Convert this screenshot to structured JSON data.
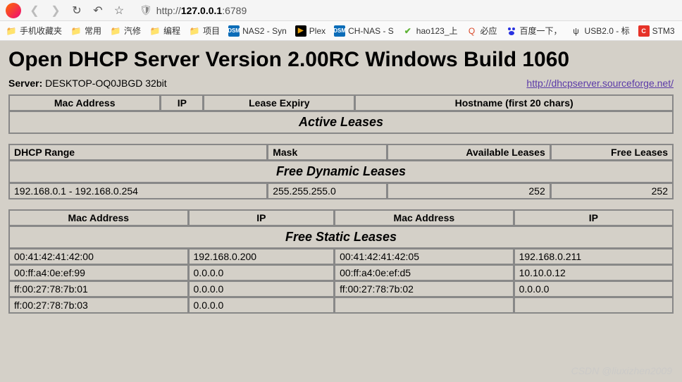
{
  "browser": {
    "url_prefix": "http://",
    "url_host": "127.0.0.1",
    "url_port": ":6789",
    "bookmarks": [
      {
        "icon": "folder",
        "label": "手机收藏夹"
      },
      {
        "icon": "folder",
        "label": "常用"
      },
      {
        "icon": "folder",
        "label": "汽修"
      },
      {
        "icon": "folder",
        "label": "编程"
      },
      {
        "icon": "folder",
        "label": "项目"
      },
      {
        "icon": "dsm",
        "label": "NAS2 - Syn"
      },
      {
        "icon": "plex",
        "label": "Plex"
      },
      {
        "icon": "dsm",
        "label": "CH-NAS - S"
      },
      {
        "icon": "hao",
        "label": "hao123_上"
      },
      {
        "icon": "biying",
        "label": "必应"
      },
      {
        "icon": "baidu",
        "label": "百度一下，"
      },
      {
        "icon": "usb",
        "label": "USB2.0 - 标"
      },
      {
        "icon": "stm",
        "label": "STM3"
      }
    ]
  },
  "page": {
    "title": "Open DHCP Server Version 2.00RC Windows Build 1060",
    "server_label": "Server:",
    "server_value": "DESKTOP-OQ0JBGD 32bit",
    "link_text": "http://dhcpserver.sourceforge.net/",
    "watermark": "CSDN @liuxizhen2009"
  },
  "active": {
    "title": "Active Leases",
    "headers": [
      "Mac Address",
      "IP",
      "Lease Expiry",
      "Hostname (first 20 chars)"
    ],
    "rows": []
  },
  "dynamic": {
    "title": "Free Dynamic Leases",
    "headers": [
      "DHCP Range",
      "Mask",
      "Available Leases",
      "Free Leases"
    ],
    "rows": [
      {
        "range": "192.168.0.1 - 192.168.0.254",
        "mask": "255.255.255.0",
        "available": "252",
        "free": "252"
      }
    ]
  },
  "static": {
    "title": "Free Static Leases",
    "headers": [
      "Mac Address",
      "IP",
      "Mac Address",
      "IP"
    ],
    "rows": [
      {
        "mac1": "00:41:42:41:42:00",
        "ip1": "192.168.0.200",
        "mac2": "00:41:42:41:42:05",
        "ip2": "192.168.0.211"
      },
      {
        "mac1": "00:ff:a4:0e:ef:99",
        "ip1": "0.0.0.0",
        "mac2": "00:ff:a4:0e:ef:d5",
        "ip2": "10.10.0.12"
      },
      {
        "mac1": "ff:00:27:78:7b:01",
        "ip1": "0.0.0.0",
        "mac2": "ff:00:27:78:7b:02",
        "ip2": "0.0.0.0"
      },
      {
        "mac1": "ff:00:27:78:7b:03",
        "ip1": "0.0.0.0",
        "mac2": "",
        "ip2": ""
      }
    ]
  }
}
